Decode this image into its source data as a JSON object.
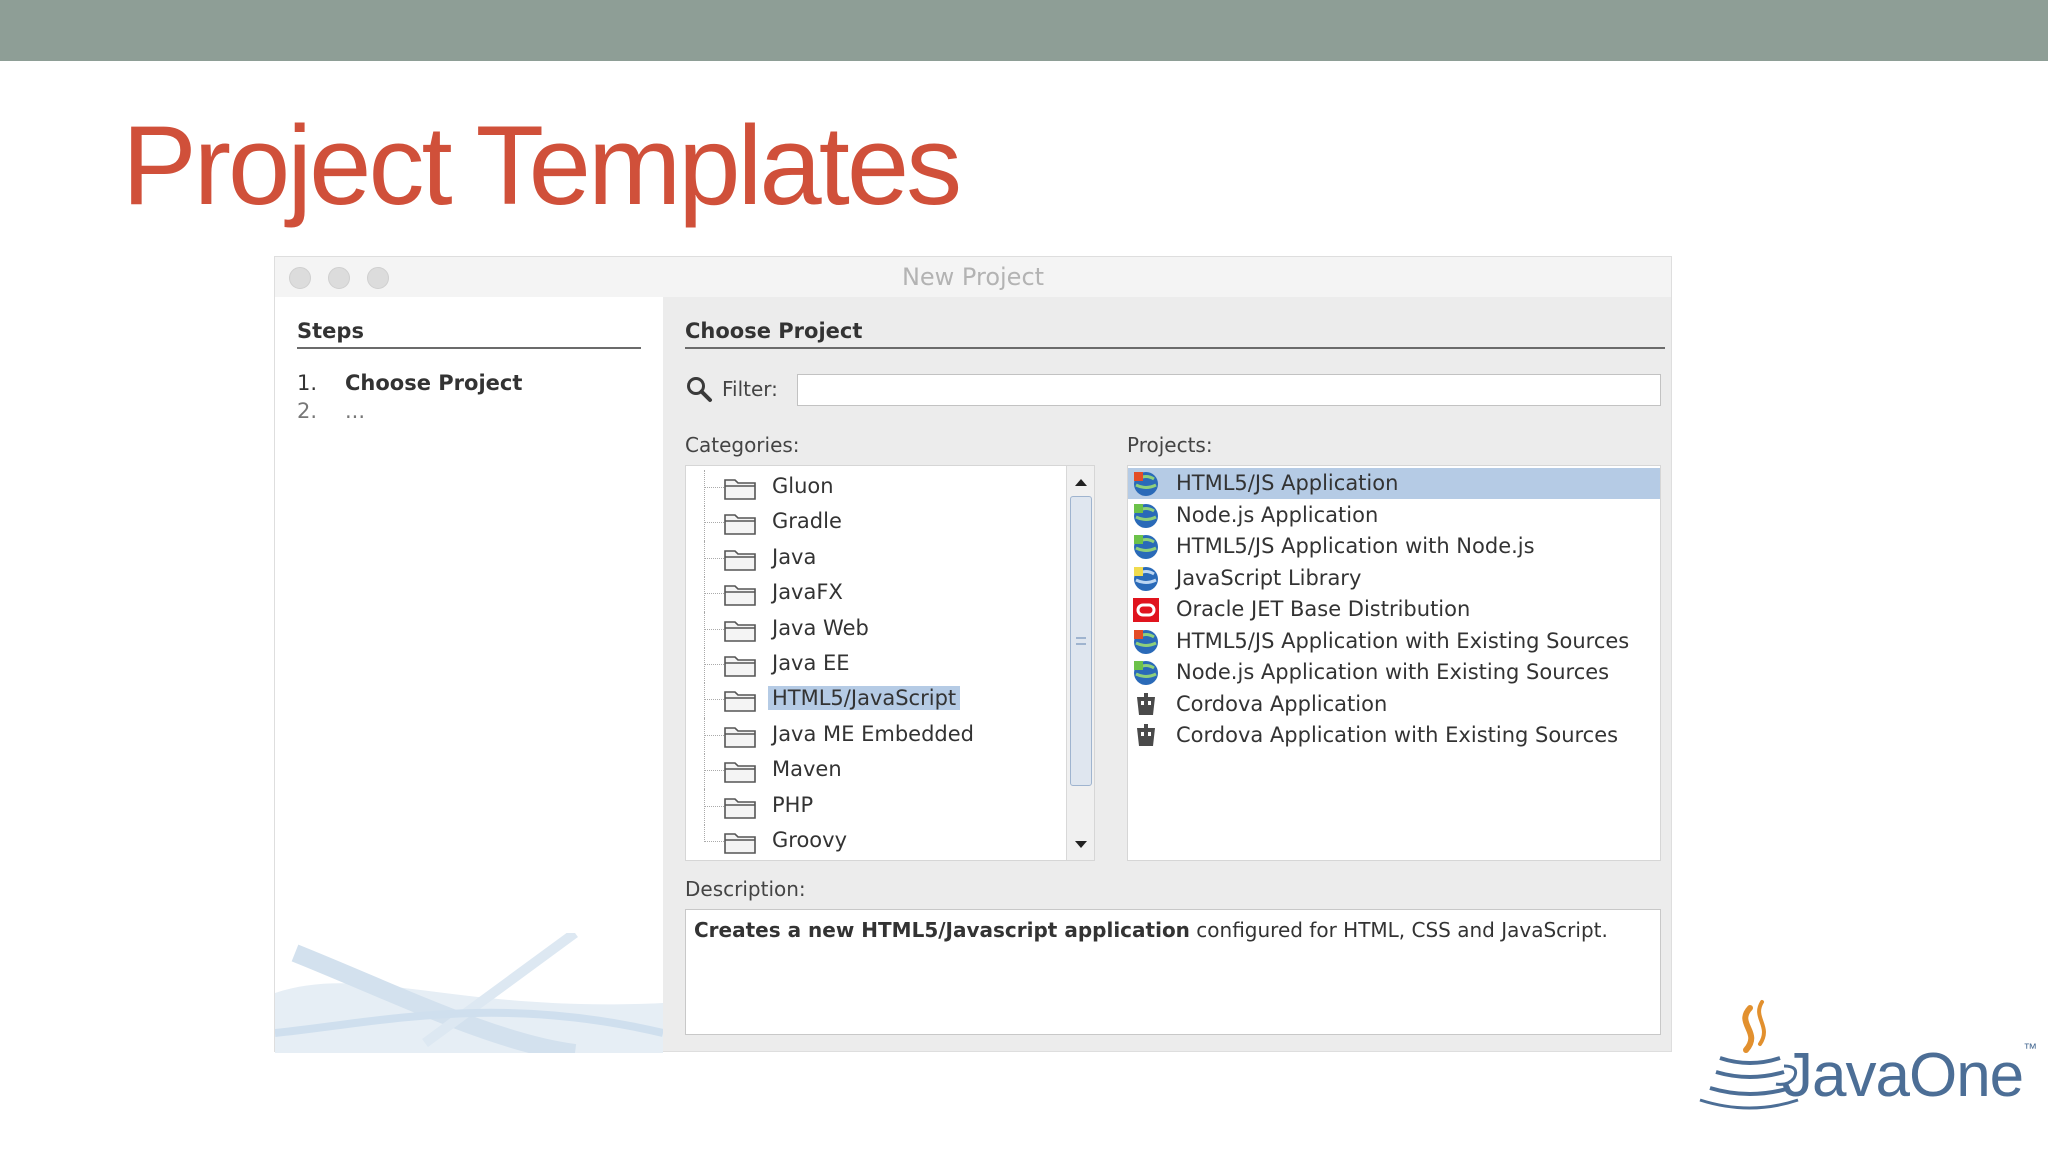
{
  "slide": {
    "title": "Project Templates",
    "logo_text": "JavaOne",
    "logo_tm": "™"
  },
  "dialog": {
    "title": "New Project",
    "steps": {
      "header": "Steps",
      "items": [
        {
          "num": "1.",
          "label": "Choose Project"
        },
        {
          "num": "2.",
          "label": "..."
        }
      ]
    },
    "header": "Choose Project",
    "filter": {
      "label": "Filter:",
      "value": ""
    },
    "categories": {
      "label": "Categories:",
      "selected": "HTML5/JavaScript",
      "items": [
        "Gluon",
        "Gradle",
        "Java",
        "JavaFX",
        "Java Web",
        "Java EE",
        "HTML5/JavaScript",
        "Java ME Embedded",
        "Maven",
        "PHP",
        "Groovy"
      ]
    },
    "projects": {
      "label": "Projects:",
      "selected": "HTML5/JS Application",
      "items": [
        {
          "label": "HTML5/JS Application",
          "icon": "html5-globe-icon"
        },
        {
          "label": "Node.js Application",
          "icon": "nodejs-globe-icon"
        },
        {
          "label": "HTML5/JS Application with Node.js",
          "icon": "nodejs-globe-icon"
        },
        {
          "label": "JavaScript Library",
          "icon": "js-library-icon"
        },
        {
          "label": "Oracle JET Base Distribution",
          "icon": "oracle-icon"
        },
        {
          "label": "HTML5/JS Application with Existing Sources",
          "icon": "html5-globe-icon"
        },
        {
          "label": "Node.js Application with Existing Sources",
          "icon": "nodejs-globe-icon"
        },
        {
          "label": "Cordova Application",
          "icon": "cordova-icon"
        },
        {
          "label": "Cordova Application with Existing Sources",
          "icon": "cordova-icon"
        }
      ]
    },
    "description": {
      "label": "Description:",
      "bold": "Creates a new HTML5/Javascript application",
      "rest": " configured for HTML, CSS and JavaScript."
    }
  },
  "colors": {
    "top_bar": "#8e9e96",
    "title": "#d0503a",
    "selection": "#b5cbe5",
    "logo": "#4c6e96"
  }
}
